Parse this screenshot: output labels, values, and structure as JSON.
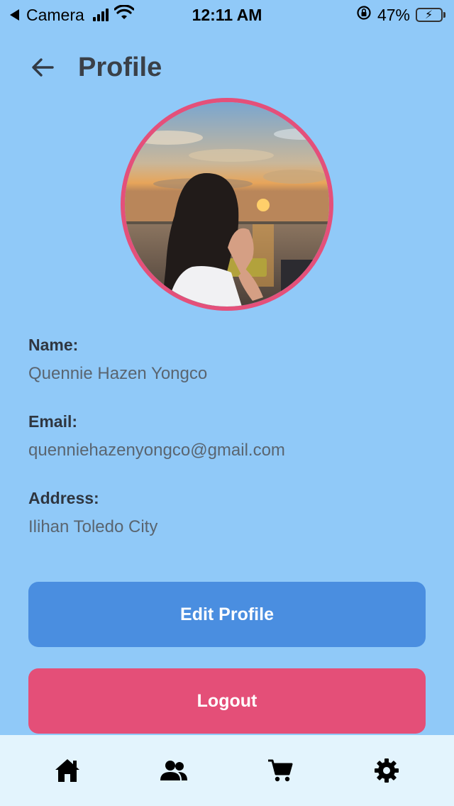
{
  "status_bar": {
    "back_app": "Camera",
    "time": "12:11 AM",
    "battery_percent": "47%",
    "battery_level": 0.47
  },
  "header": {
    "title": "Profile",
    "back_icon": "arrow-left-icon"
  },
  "profile": {
    "avatar_description": "photo-of-person-watching-sunset",
    "fields": [
      {
        "label": "Name:",
        "value": "Quennie Hazen Yongco"
      },
      {
        "label": "Email:",
        "value": "quenniehazenyongco@gmail.com"
      },
      {
        "label": "Address:",
        "value": "Ilihan Toledo City"
      }
    ]
  },
  "actions": {
    "edit_label": "Edit Profile",
    "logout_label": "Logout"
  },
  "bottom_nav": {
    "items": [
      "home-icon",
      "users-icon",
      "cart-icon",
      "gear-icon"
    ]
  },
  "colors": {
    "background": "#90c9f8",
    "edit_button": "#4a8ee0",
    "logout_button": "#e44f78",
    "avatar_border": "#e4507a",
    "nav_background": "#e3f4fd"
  }
}
